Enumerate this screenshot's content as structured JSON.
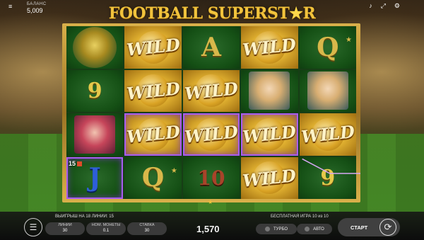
{
  "game": {
    "title_main": "FOOTBALL SUPERST",
    "title_star": "★",
    "title_end": "R"
  },
  "balance": {
    "label": "БАЛАНС",
    "value": "5,009"
  },
  "top_icons": {
    "sound": "speaker-icon",
    "fullscreen": "fullscreen-icon",
    "settings": "settings-icon"
  },
  "reels": [
    [
      {
        "type": "trophy"
      },
      {
        "type": "wild",
        "text": "WILD"
      },
      {
        "type": "letter",
        "text": "A"
      },
      {
        "type": "wild",
        "text": "WILD"
      },
      {
        "type": "letter",
        "text": "Q",
        "star": true
      }
    ],
    [
      {
        "type": "nine",
        "text": "9"
      },
      {
        "type": "wild",
        "text": "WILD"
      },
      {
        "type": "wild",
        "text": "WILD"
      },
      {
        "type": "portrait",
        "variant": "blonde"
      },
      {
        "type": "portrait",
        "variant": "blonde"
      }
    ],
    [
      {
        "type": "portrait",
        "variant": "red"
      },
      {
        "type": "wild",
        "text": "WILD",
        "hl": true
      },
      {
        "type": "wild",
        "text": "WILD",
        "hl": true
      },
      {
        "type": "wild",
        "text": "WILD",
        "hl": true
      },
      {
        "type": "wild",
        "text": "WILD"
      }
    ],
    [
      {
        "type": "jack",
        "text": "J",
        "hl": true,
        "win": "15"
      },
      {
        "type": "letter",
        "text": "Q",
        "star": true
      },
      {
        "type": "ten",
        "text": "10"
      },
      {
        "type": "wild",
        "text": "WILD"
      },
      {
        "type": "nine",
        "text": "9"
      }
    ]
  ],
  "hud": {
    "win_info": "ВЫИГРЫШ НА 18 ЛИНИИ: 15",
    "free_info": "БЕСПЛАТНАЯ ИГРА 10 из 10",
    "lines_label": "ЛИНИИ",
    "lines_value": "30",
    "coin_label": "НОМ. МОНЕТЫ",
    "coin_value": "0.1",
    "bet_label": "СТАВКА",
    "bet_value": "30",
    "total": "1,570",
    "turbo": "ТУРБО",
    "auto": "АВТО",
    "start": "СТАРТ"
  },
  "colors": {
    "accent_gold": "#f1c33c",
    "highlight": "#a75cf0"
  }
}
